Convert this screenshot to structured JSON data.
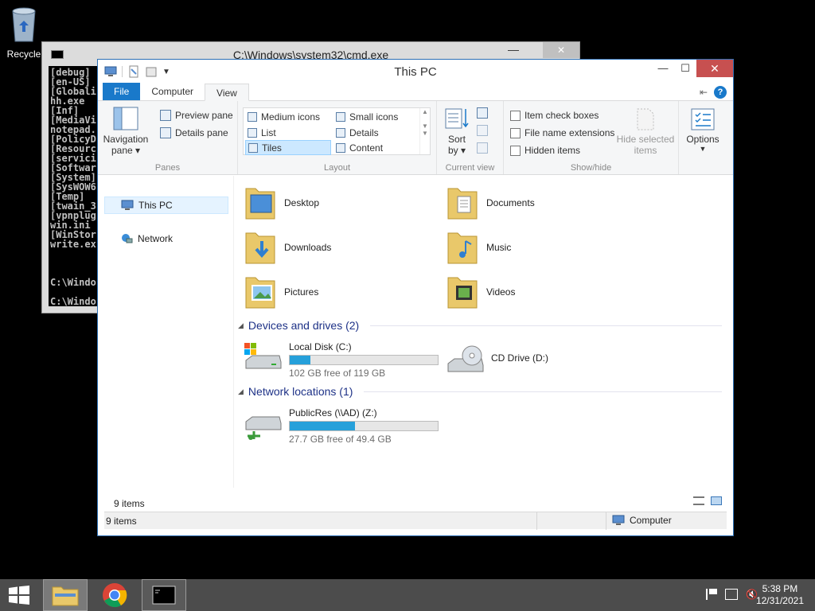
{
  "desktop": {
    "recycle_label": "Recycle"
  },
  "cmd": {
    "title": "C:\\Windows\\system32\\cmd.exe",
    "lines": [
      "[debug]",
      "[en-US]",
      "[Globali",
      "hh.exe",
      "[Inf]",
      "[MediaVi",
      "notepad.",
      "[PolicyD",
      "[Resourc",
      "[servici",
      "[Softwar",
      "[System]",
      "[SysWOW6",
      "[Temp]",
      "[twain_3",
      "[vpnplug",
      "win.ini",
      "[WinStor",
      "write.ex",
      "",
      "",
      "",
      "C:\\Windo",
      "",
      "C:\\Windo"
    ]
  },
  "explorer": {
    "title": "This PC",
    "tabs": {
      "file": "File",
      "computer": "Computer",
      "view": "View"
    },
    "ribbon": {
      "panes": {
        "navigation_pane": "Navigation",
        "navigation_pane2": "pane",
        "preview_pane": "Preview pane",
        "details_pane": "Details pane",
        "label": "Panes"
      },
      "layout": {
        "medium_icons": "Medium icons",
        "small_icons": "Small icons",
        "list": "List",
        "details": "Details",
        "tiles": "Tiles",
        "content": "Content",
        "label": "Layout"
      },
      "current_view": {
        "sort_by": "Sort",
        "sort_by2": "by",
        "label": "Current view"
      },
      "show_hide": {
        "item_check_boxes": "Item check boxes",
        "file_name_extensions": "File name extensions",
        "hidden_items": "Hidden items",
        "hide_selected": "Hide selected",
        "hide_selected2": "items",
        "label": "Show/hide"
      },
      "options": "Options"
    },
    "nav": {
      "this_pc": "This PC",
      "network": "Network"
    },
    "folders": [
      "Desktop",
      "Documents",
      "Downloads",
      "Music",
      "Pictures",
      "Videos"
    ],
    "sections": {
      "devices": "Devices and drives (2)",
      "network": "Network locations (1)"
    },
    "drives": {
      "local": {
        "name": "Local Disk (C:)",
        "free": "102 GB free of 119 GB",
        "used_fraction": 0.14
      },
      "cd": {
        "name": "CD Drive (D:)"
      },
      "netdrive": {
        "name": "PublicRes (\\\\AD) (Z:)",
        "free": "27.7 GB free of 49.4 GB",
        "used_fraction": 0.44
      }
    },
    "item_count": "9 items",
    "status": {
      "left": "9 items",
      "right": "Computer"
    }
  },
  "taskbar": {
    "time": "5:38 PM",
    "date": "12/31/2021"
  },
  "colors": {
    "accent": "#1979ca",
    "drivebar": "#26a0da",
    "taskbar": "#4c4c4c"
  }
}
